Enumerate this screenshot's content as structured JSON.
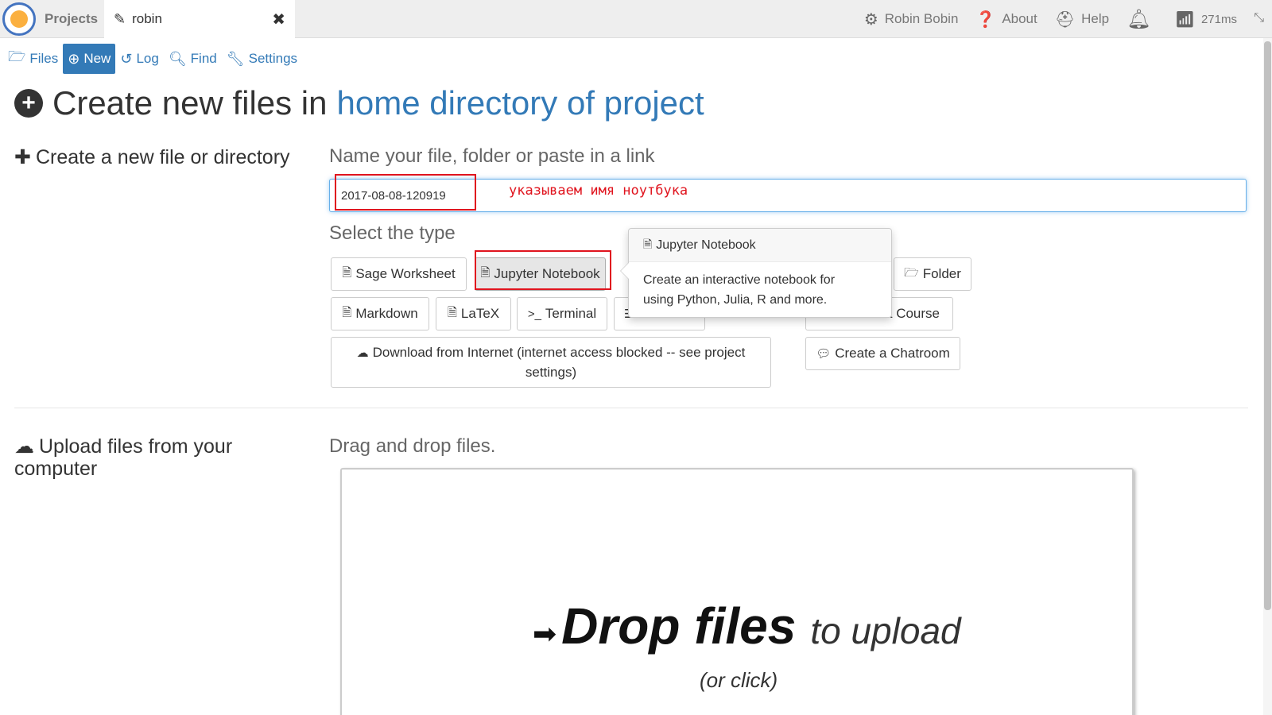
{
  "topbar": {
    "projects_label": "Projects",
    "file_tab": {
      "label": "robin",
      "close": "✖"
    },
    "user": "Robin Bobin",
    "about": "About",
    "help": "Help",
    "ping": "271ms"
  },
  "projnav": {
    "files": "Files",
    "new": "New",
    "log": "Log",
    "find": "Find",
    "settings": "Settings"
  },
  "heading": {
    "prefix": "Create new files in",
    "link": "home directory of project"
  },
  "create_section": {
    "title": "Create a new file or directory",
    "name_label": "Name your file, folder or paste in a link",
    "name_value": "2017-08-08-120919",
    "annotation": "указываем имя  ноутбука",
    "type_label": "Select the type"
  },
  "types": {
    "sage": "Sage Worksheet",
    "jupyter": "Jupyter Notebook",
    "folder": "Folder",
    "markdown": "Markdown",
    "latex": "LaTeX",
    "terminal": "Terminal",
    "course": "a Course",
    "download_line1": "Download from Internet (internet access blocked -- see project",
    "download_line2": "settings)",
    "chatroom": "Create a Chatroom"
  },
  "popover": {
    "title": "Jupyter Notebook",
    "line1": "Create an interactive notebook for",
    "line2": "using Python, Julia, R and more."
  },
  "upload": {
    "title_line1": "Upload files from your",
    "title_line2": "computer",
    "dd_label": "Drag and drop files.",
    "drop_bold": "Drop files",
    "drop_rest": "to upload",
    "drop_sub": "(or click)"
  },
  "colors": {
    "link": "#337ab7",
    "annotation": "#e0141e"
  }
}
